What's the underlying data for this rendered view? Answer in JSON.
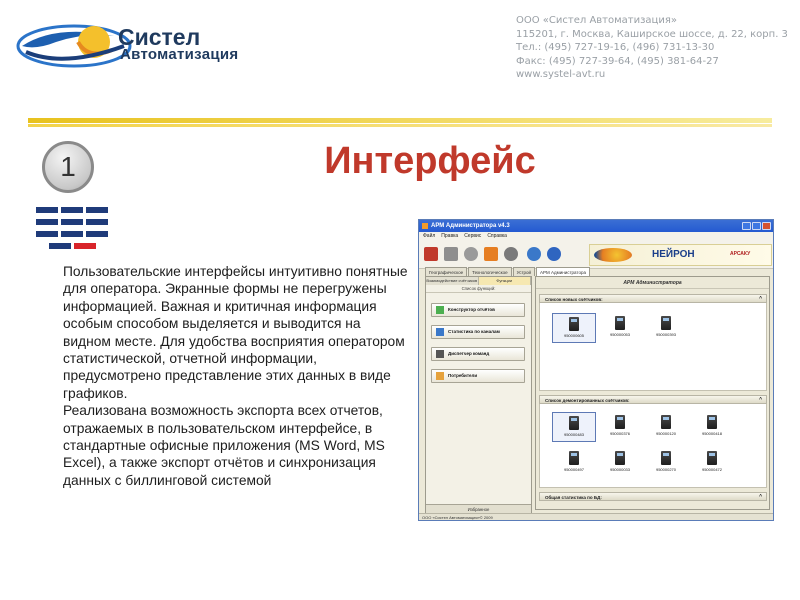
{
  "header": {
    "logo_line1": "Систел",
    "logo_line2": "Автоматизация",
    "company_lines": [
      "ООО «Систел Автоматизация»",
      "115201, г. Москва, Каширское шоссе, д. 22, корп. 3",
      "Тел.: (495) 727-19-16, (496) 731-13-30",
      "Факс: (495) 727-39-64, (495) 381-64-27",
      "www.systel-avt.ru"
    ]
  },
  "slide": {
    "number": "1",
    "title": "Интерфейс",
    "paragraph1": "Пользовательские интерфейсы интуитивно понятные для оператора. Экранные формы не перегружены информацией. Важная и критичная информация особым способом выделяется и выводится на видном месте. Для удобства восприятия оператором статистической, отчетной информации, предусмотрено представление этих данных в виде графиков.",
    "paragraph2": "Реализована возможность экспорта всех отчетов, отражаемых в пользовательском интерфейсе,  в стандартные офисные приложения (MS Word, MS Excel), а также экспорт отчётов и синхронизация данных с биллинговой системой"
  },
  "app": {
    "title": "АРМ Администратора v4.3",
    "menu": [
      "Файл",
      "Правка",
      "Сервис",
      "Справка"
    ],
    "banner_main": "НЕЙРОН",
    "banner_side": "АРСАКУ",
    "tabs": [
      "Географическое",
      "Технологическое",
      "Устрой",
      "АРМ Администратора"
    ],
    "left_tabs": [
      "Взаимодействие счётчиков",
      "Функции"
    ],
    "left_title": "Список функций:",
    "left_items": [
      "Конструктор отчётов",
      "Статистика по каналам",
      "Диспетчер команд",
      "Потребители"
    ],
    "left_footer": "Избранное",
    "right_header": "АРМ Администратора",
    "group1_title": "Список новых счётчиков:",
    "group1_meters": [
      "950000605",
      "950000053",
      "950000393"
    ],
    "group2_title": "Список демонтированных счётчиков:",
    "group2_meters": [
      "950000483",
      "950000376",
      "950000120",
      "950000418",
      "950000497",
      "950000033",
      "950000270",
      "950000472"
    ],
    "group3_title": "Общая статистика по БД:",
    "status": "ООО «Систел Автоматизация»© 2009"
  }
}
